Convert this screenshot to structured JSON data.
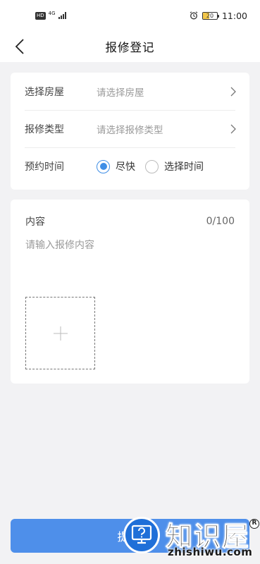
{
  "status_bar": {
    "hd": "HD",
    "network": "4G",
    "battery": "20",
    "time": "11:00"
  },
  "header": {
    "title": "报修登记"
  },
  "form": {
    "house_label": "选择房屋",
    "house_placeholder": "请选择房屋",
    "type_label": "报修类型",
    "type_placeholder": "请选择报修类型",
    "time_label": "预约时间",
    "time_options": [
      {
        "label": "尽快",
        "selected": true
      },
      {
        "label": "选择时间",
        "selected": false
      }
    ]
  },
  "content": {
    "label": "内容",
    "count": "0/100",
    "placeholder": "请输入报修内容"
  },
  "submit": {
    "label": "提交"
  },
  "watermark": {
    "brand": "知识屋",
    "domain": "zhishiwu.com",
    "reg_mark": "R"
  },
  "colors": {
    "accent": "#4e8fea",
    "radio": "#3f8ee6",
    "background": "#f2f2f4"
  }
}
